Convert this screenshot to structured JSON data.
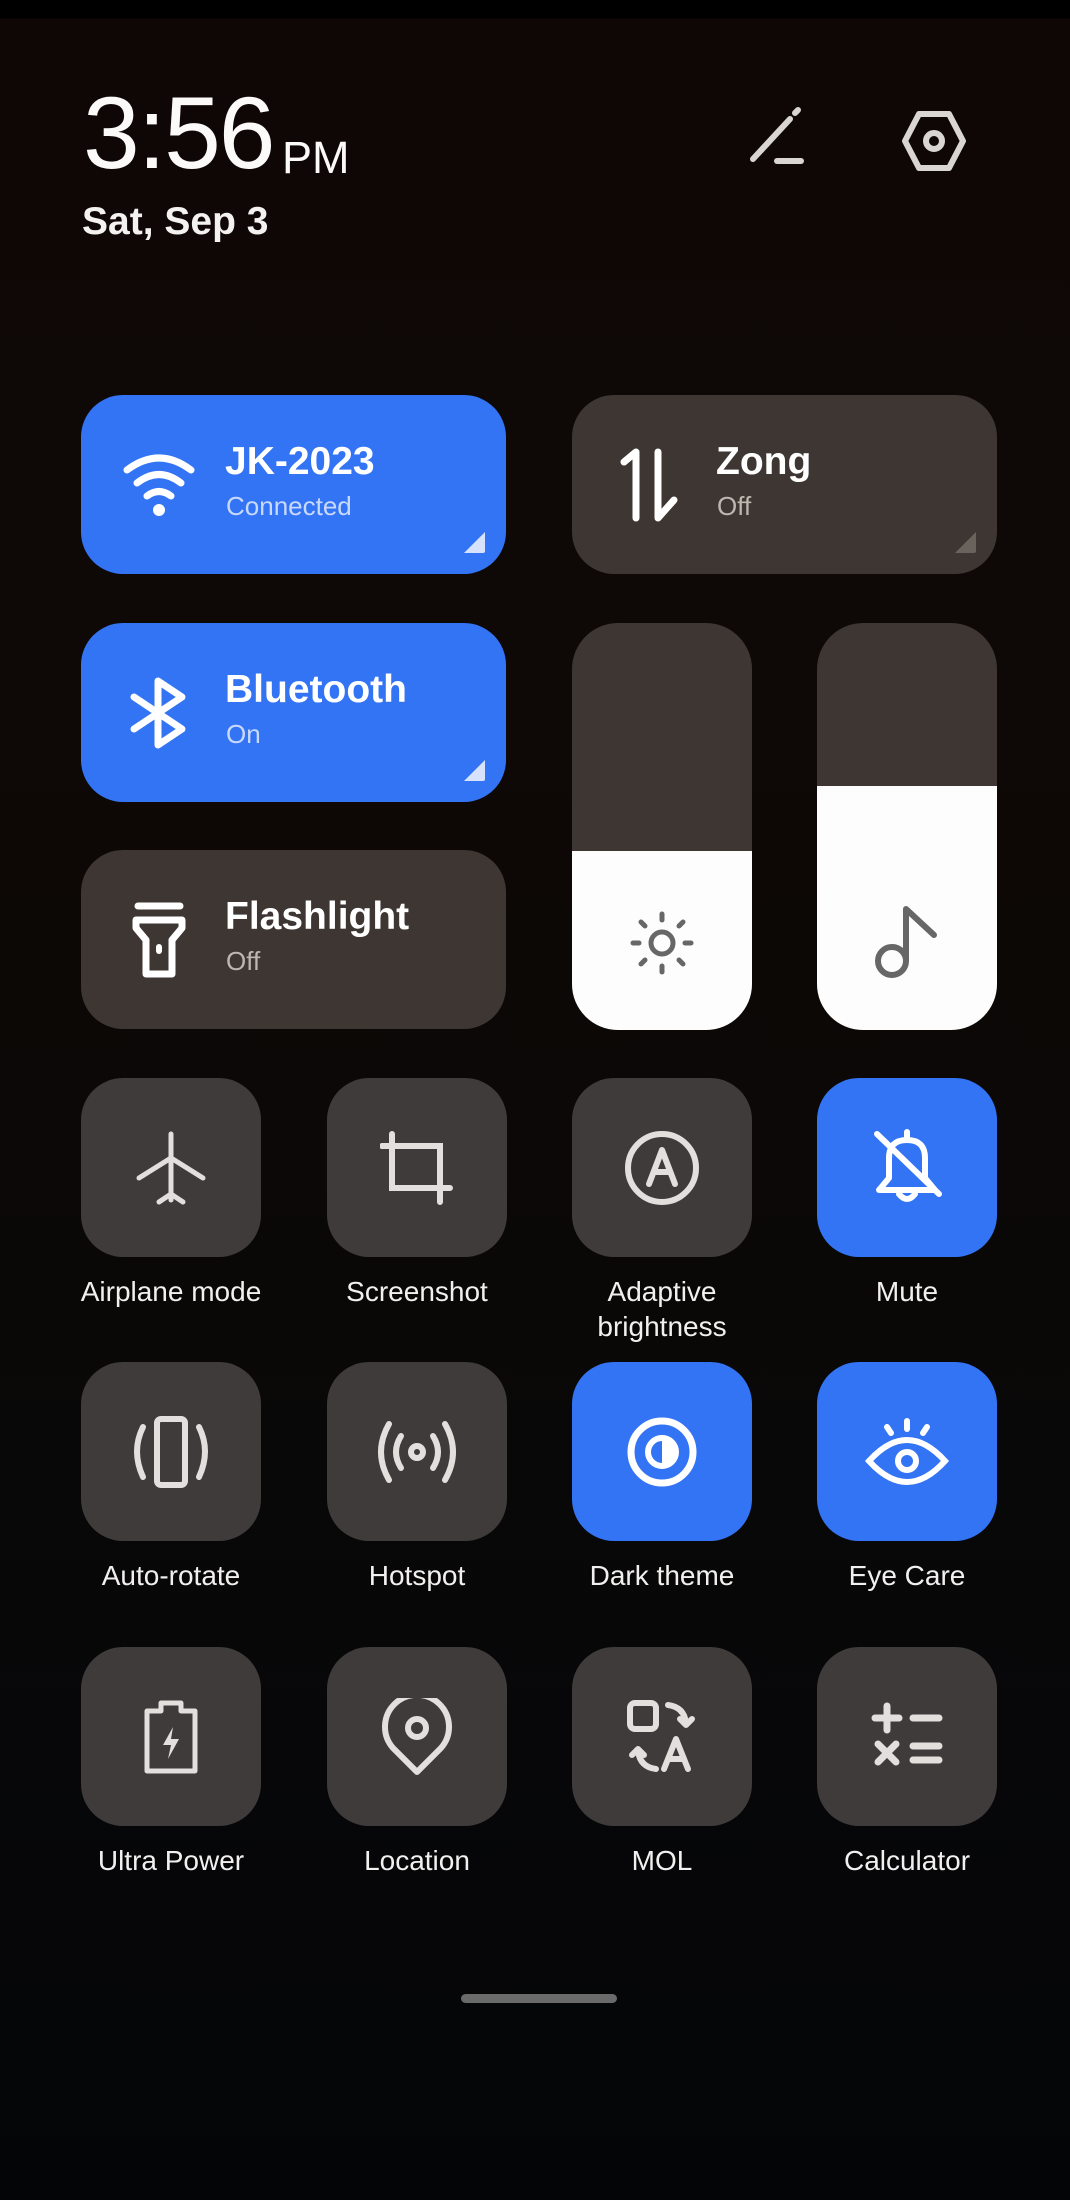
{
  "header": {
    "time": "3:56",
    "ampm": "PM",
    "date": "Sat, Sep 3",
    "edit_icon": "pencil-edit-icon",
    "settings_icon": "hexagon-settings-icon"
  },
  "colors": {
    "accent": "#3374f5",
    "tile_off": "#3d3632",
    "slider_fill": "#fdfdfd"
  },
  "large_tiles": {
    "wifi": {
      "title": "JK-2023",
      "subtitle": "Connected",
      "state": "on",
      "icon": "wifi-icon"
    },
    "mobile_data": {
      "title": "Zong",
      "subtitle": "Off",
      "state": "off",
      "icon": "up-down-arrows-icon"
    },
    "bluetooth": {
      "title": "Bluetooth",
      "subtitle": "On",
      "state": "on",
      "icon": "bluetooth-icon"
    },
    "flashlight": {
      "title": "Flashlight",
      "subtitle": "Off",
      "state": "off",
      "icon": "flashlight-icon"
    }
  },
  "sliders": {
    "brightness": {
      "level": 0.44,
      "icon": "sun-icon"
    },
    "volume": {
      "level": 0.6,
      "icon": "music-note-icon"
    }
  },
  "small_tiles": [
    {
      "label": "Airplane mode",
      "state": "off",
      "icon": "airplane-icon"
    },
    {
      "label": "Screenshot",
      "state": "off",
      "icon": "crop-icon"
    },
    {
      "label": "Adaptive brightness",
      "state": "off",
      "icon": "auto-brightness-icon"
    },
    {
      "label": "Mute",
      "state": "on",
      "icon": "bell-off-icon"
    },
    {
      "label": "Auto-rotate",
      "state": "off",
      "icon": "rotate-phone-icon"
    },
    {
      "label": "Hotspot",
      "state": "off",
      "icon": "hotspot-icon"
    },
    {
      "label": "Dark theme",
      "state": "on",
      "icon": "dark-theme-icon"
    },
    {
      "label": "Eye Care",
      "state": "on",
      "icon": "eye-icon"
    },
    {
      "label": "Ultra Power",
      "state": "off",
      "icon": "battery-bolt-icon"
    },
    {
      "label": "Location",
      "state": "off",
      "icon": "location-pin-icon"
    },
    {
      "label": "MOL",
      "state": "off",
      "icon": "translate-icon"
    },
    {
      "label": "Calculator",
      "state": "off",
      "icon": "calculator-icon"
    }
  ]
}
